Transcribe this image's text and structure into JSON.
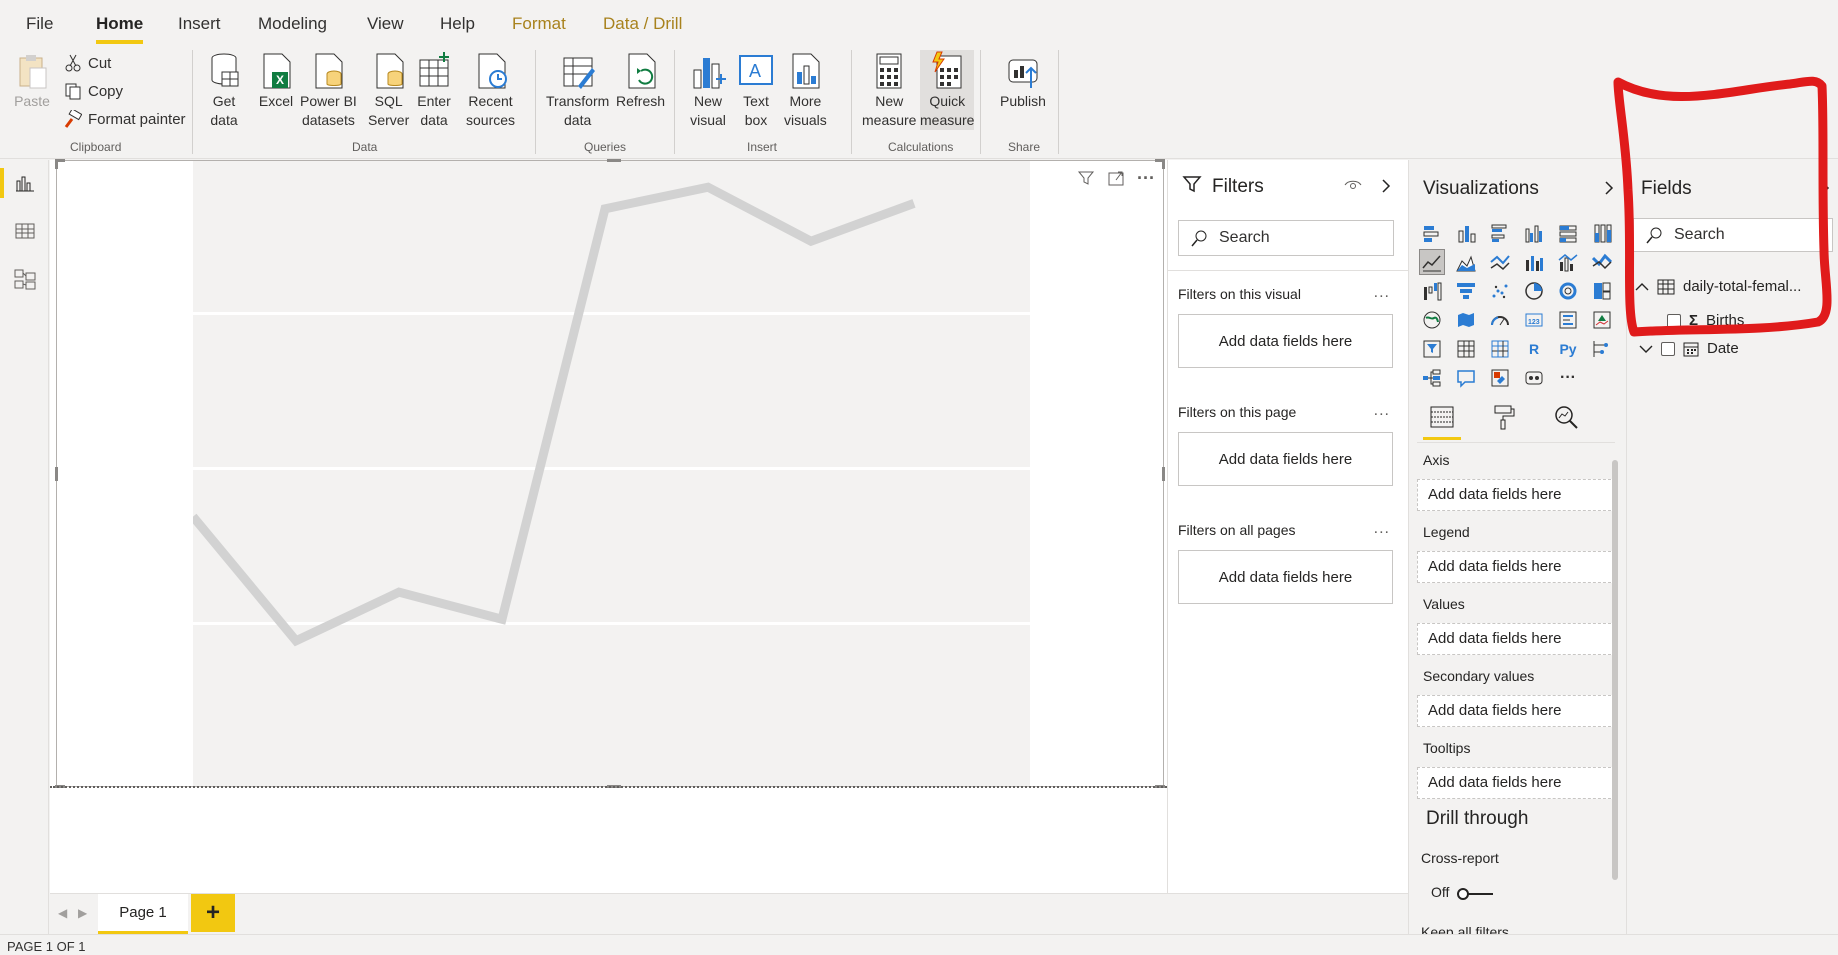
{
  "menu": {
    "tabs": [
      "File",
      "Home",
      "Insert",
      "Modeling",
      "View",
      "Help",
      "Format",
      "Data / Drill"
    ]
  },
  "ribbon": {
    "clipboard": {
      "paste": "Paste",
      "cut": "Cut",
      "copy": "Copy",
      "format_painter": "Format painter",
      "label": "Clipboard"
    },
    "data": {
      "get_data": "Get\ndata",
      "excel": "Excel",
      "power_bi_datasets": "Power BI\ndatasets",
      "sql_server": "SQL\nServer",
      "enter_data": "Enter\ndata",
      "recent_sources": "Recent\nsources",
      "label": "Data"
    },
    "queries": {
      "transform_data": "Transform\ndata",
      "refresh": "Refresh",
      "label": "Queries"
    },
    "insert": {
      "new_visual": "New\nvisual",
      "text_box": "Text\nbox",
      "more_visuals": "More\nvisuals",
      "label": "Insert"
    },
    "calculations": {
      "new_measure": "New\nmeasure",
      "quick_measure": "Quick\nmeasure",
      "label": "Calculations"
    },
    "share": {
      "publish": "Publish",
      "label": "Share"
    }
  },
  "visual": {
    "more_options": "···"
  },
  "pages": {
    "tab": "Page 1",
    "add": "+",
    "status": "PAGE 1 OF 1"
  },
  "filters": {
    "title": "Filters",
    "search_placeholder": "Search",
    "sections": [
      {
        "label": "Filters on this visual",
        "drop": "Add data fields here"
      },
      {
        "label": "Filters on this page",
        "drop": "Add data fields here"
      },
      {
        "label": "Filters on all pages",
        "drop": "Add data fields here"
      }
    ],
    "more": "..."
  },
  "visualizations": {
    "title": "Visualizations",
    "icon_r": "R",
    "icon_py": "Py",
    "icon_more": "···",
    "wells": [
      {
        "label": "Axis",
        "placeholder": "Add data fields here"
      },
      {
        "label": "Legend",
        "placeholder": "Add data fields here"
      },
      {
        "label": "Values",
        "placeholder": "Add data fields here"
      },
      {
        "label": "Secondary values",
        "placeholder": "Add data fields here"
      },
      {
        "label": "Tooltips",
        "placeholder": "Add data fields here"
      }
    ],
    "drill_through": "Drill through",
    "cross_report": "Cross-report",
    "toggle_off": "Off",
    "keep_all_filters": "Keep all filters"
  },
  "fields": {
    "title": "Fields",
    "search_placeholder": "Search",
    "table_name": "daily-total-femal...",
    "items": [
      {
        "name": "Births",
        "icon": "sigma-icon"
      },
      {
        "name": "Date",
        "icon": "calendar-icon"
      }
    ]
  },
  "colors": {
    "accent": "#f2c811",
    "annotation": "#e01b1b",
    "line": "#d2d2d2"
  },
  "line_chart": {
    "values": [
      0.36,
      0.13,
      0.22,
      0.17,
      0.93,
      0.97,
      0.87,
      0.94
    ]
  }
}
